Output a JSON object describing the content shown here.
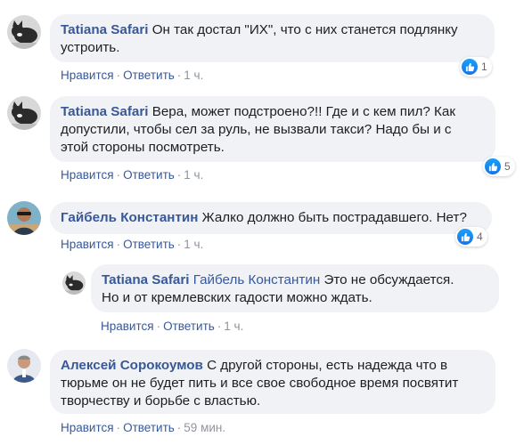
{
  "comments": [
    {
      "author": "Tatiana Safari",
      "text": " Он так достал \"ИХ\", что с них станется подлянку\nустроить.",
      "like_label": "Нравится",
      "reply_label": "Ответить",
      "time": "1 ч.",
      "reactions": "1",
      "avatar": "cat-avatar"
    },
    {
      "author": "Tatiana Safari",
      "text": " Вера, может подстроено?!! Где и с кем пил? Как\nдопустили, чтобы сел за руль, не вызвали такси? Надо бы и с\nэтой стороны посмотреть.",
      "like_label": "Нравится",
      "reply_label": "Ответить",
      "time": "1 ч.",
      "reactions": "5",
      "avatar": "cat-avatar"
    },
    {
      "author": "Гайбель Константин",
      "text": " Жалко должно быть пострадавшего. Нет?",
      "like_label": "Нравится",
      "reply_label": "Ответить",
      "time": "1 ч.",
      "reactions": "4",
      "avatar": "man-sunglasses-avatar"
    },
    {
      "author": "Tatiana Safari",
      "mention": "Гайбель Константин",
      "text": " Это не обсуждается.\nНо и от кремлевских гадости можно ждать.",
      "like_label": "Нравится",
      "reply_label": "Ответить",
      "time": "1 ч.",
      "avatar": "cat-avatar"
    },
    {
      "author": "Алексей Сорокоумов",
      "text": " С другой стороны, есть надежда что в\nтюрьме он не будет пить и все свое свободное время посвятит\nтворчеству и борьбе с властью.",
      "like_label": "Нравится",
      "reply_label": "Ответить",
      "time": "59 мин.",
      "avatar": "man-avatar"
    }
  ],
  "colors": {
    "bubble": "#f0f2f5",
    "author": "#385898",
    "like_blue": "#1877f2"
  }
}
